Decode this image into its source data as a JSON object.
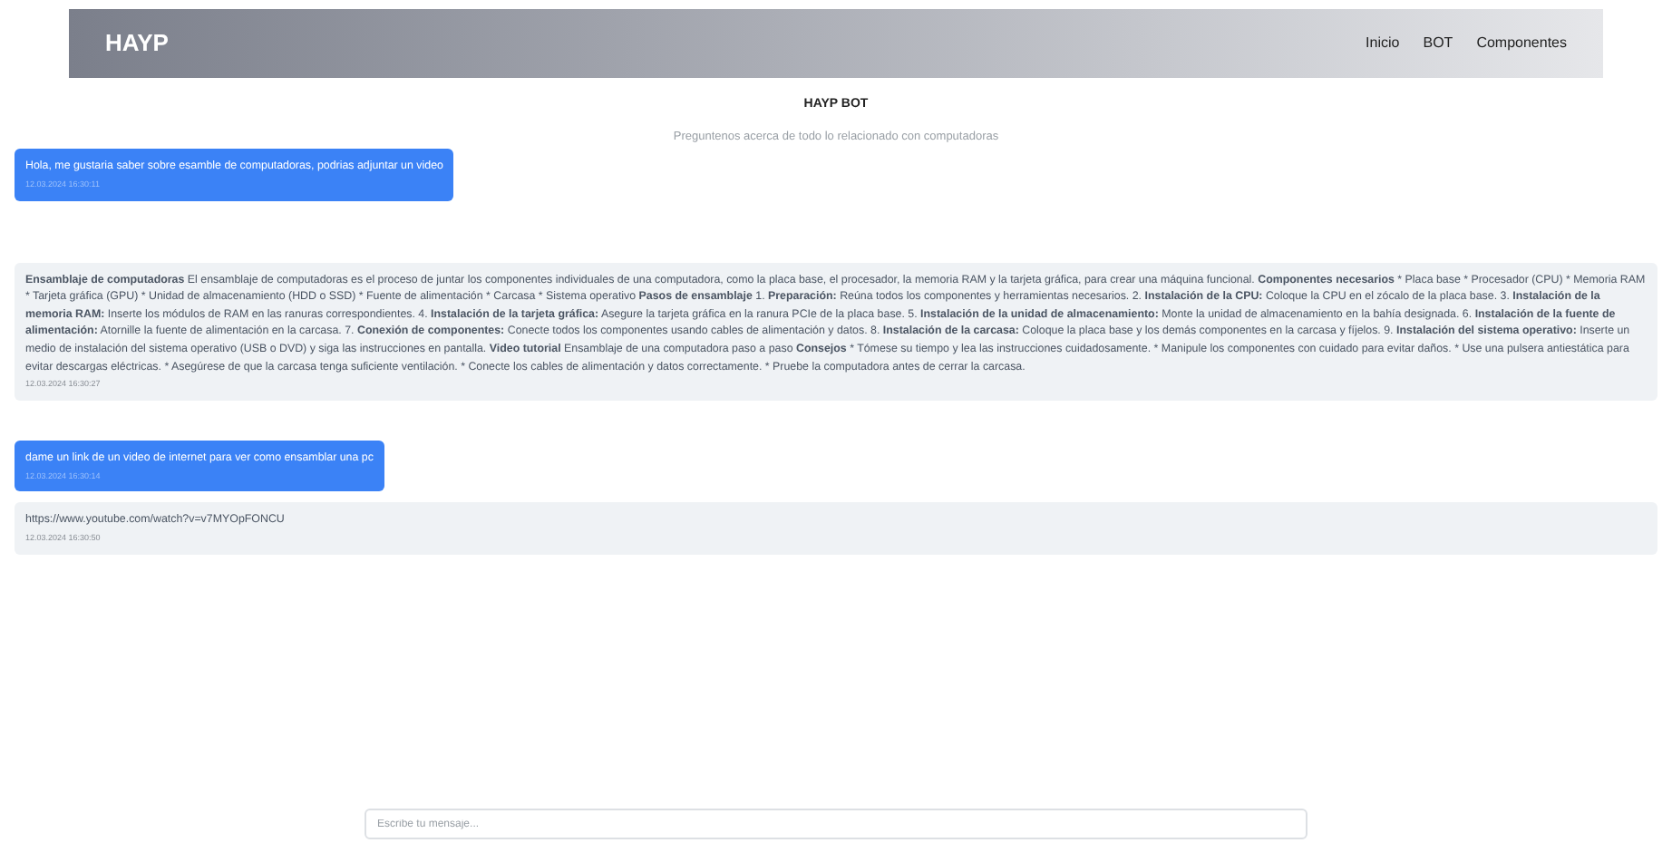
{
  "navbar": {
    "brand": "HAYP",
    "links": [
      "Inicio",
      "BOT",
      "Componentes"
    ]
  },
  "header": {
    "title": "HAYP BOT",
    "subtitle": "Preguntenos acerca de todo lo relacionado con computadoras"
  },
  "messages": [
    {
      "kind": "user",
      "segments": [
        {
          "text": "Hola, me gustaria saber sobre esamble de computadoras, podrias adjuntar un video",
          "bold": false
        }
      ],
      "time": "12.03.2024 16:30:11"
    },
    {
      "kind": "bot",
      "segments": [
        {
          "text": "Ensamblaje de computadoras",
          "bold": true
        },
        {
          "text": " El ensamblaje de computadoras es el proceso de juntar los componentes individuales de una computadora, como la placa base, el procesador, la memoria RAM y la tarjeta gráfica, para crear una máquina funcional. ",
          "bold": false
        },
        {
          "text": "Componentes necesarios",
          "bold": true
        },
        {
          "text": " * Placa base * Procesador (CPU) * Memoria RAM * Tarjeta gráfica (GPU) * Unidad de almacenamiento (HDD o SSD) * Fuente de alimentación * Carcasa * Sistema operativo ",
          "bold": false
        },
        {
          "text": "Pasos de ensamblaje",
          "bold": true
        },
        {
          "text": " 1. ",
          "bold": false
        },
        {
          "text": "Preparación:",
          "bold": true
        },
        {
          "text": " Reúna todos los componentes y herramientas necesarios. 2. ",
          "bold": false
        },
        {
          "text": "Instalación de la CPU:",
          "bold": true
        },
        {
          "text": " Coloque la CPU en el zócalo de la placa base. 3. ",
          "bold": false
        },
        {
          "text": "Instalación de la memoria RAM:",
          "bold": true
        },
        {
          "text": " Inserte los módulos de RAM en las ranuras correspondientes. 4. ",
          "bold": false
        },
        {
          "text": "Instalación de la tarjeta gráfica:",
          "bold": true
        },
        {
          "text": " Asegure la tarjeta gráfica en la ranura PCIe de la placa base. 5. ",
          "bold": false
        },
        {
          "text": "Instalación de la unidad de almacenamiento:",
          "bold": true
        },
        {
          "text": " Monte la unidad de almacenamiento en la bahía designada. 6. ",
          "bold": false
        },
        {
          "text": "Instalación de la fuente de alimentación:",
          "bold": true
        },
        {
          "text": " Atornille la fuente de alimentación en la carcasa. 7. ",
          "bold": false
        },
        {
          "text": "Conexión de componentes:",
          "bold": true
        },
        {
          "text": " Conecte todos los componentes usando cables de alimentación y datos. 8. ",
          "bold": false
        },
        {
          "text": "Instalación de la carcasa:",
          "bold": true
        },
        {
          "text": " Coloque la placa base y los demás componentes en la carcasa y fíjelos. 9. ",
          "bold": false
        },
        {
          "text": "Instalación del sistema operativo:",
          "bold": true
        },
        {
          "text": " Inserte un medio de instalación del sistema operativo (USB o DVD) y siga las instrucciones en pantalla. ",
          "bold": false
        },
        {
          "text": "Video tutorial",
          "bold": true
        },
        {
          "text": " Ensamblaje de una computadora paso a paso ",
          "bold": false
        },
        {
          "text": "Consejos",
          "bold": true
        },
        {
          "text": " * Tómese su tiempo y lea las instrucciones cuidadosamente. * Manipule los componentes con cuidado para evitar daños. * Use una pulsera antiestática para evitar descargas eléctricas. * Asegúrese de que la carcasa tenga suficiente ventilación. * Conecte los cables de alimentación y datos correctamente. * Pruebe la computadora antes de cerrar la carcasa.",
          "bold": false
        }
      ],
      "time": "12.03.2024 16:30:27"
    },
    {
      "kind": "user",
      "segments": [
        {
          "text": "dame un link de un video de internet para ver como ensamblar una pc",
          "bold": false
        }
      ],
      "time": "12.03.2024 16:30:14"
    },
    {
      "kind": "bot",
      "segments": [
        {
          "text": "https://www.youtube.com/watch?v=v7MYOpFONCU",
          "bold": false
        }
      ],
      "time": "12.03.2024 16:30:50"
    }
  ],
  "composer": {
    "placeholder": "Escribe tu mensaje..."
  }
}
